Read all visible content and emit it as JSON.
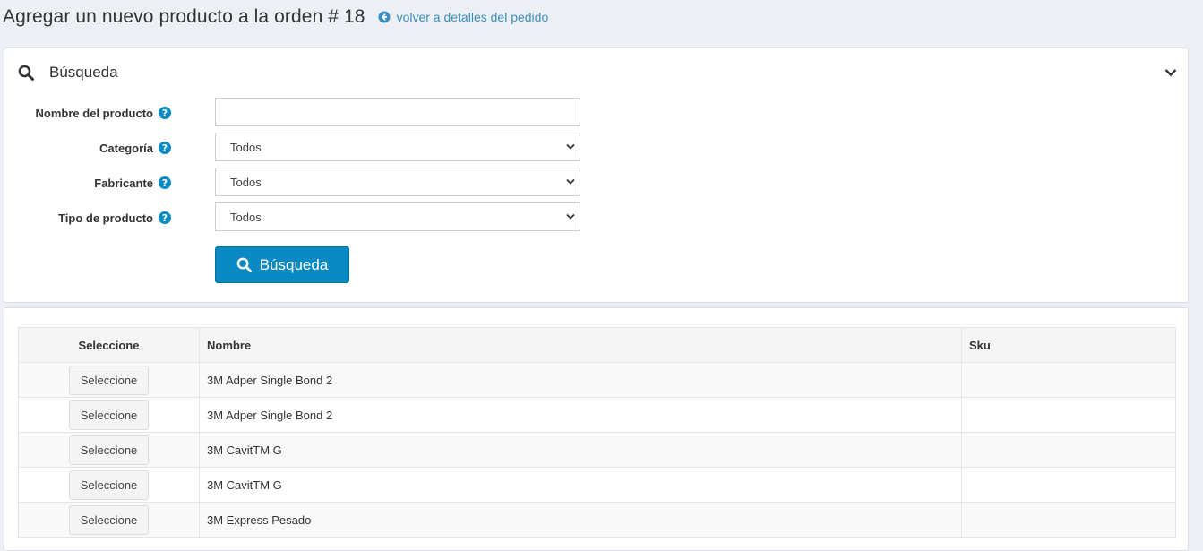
{
  "header": {
    "title": "Agregar un nuevo producto a la orden # 18",
    "back_link": "volver a detalles del pedido"
  },
  "search": {
    "title": "Búsqueda",
    "fields": {
      "product_name": {
        "label": "Nombre del producto",
        "value": ""
      },
      "category": {
        "label": "Categoría",
        "value": "Todos"
      },
      "manufacturer": {
        "label": "Fabricante",
        "value": "Todos"
      },
      "product_type": {
        "label": "Tipo de producto",
        "value": "Todos"
      }
    },
    "button_label": "Búsqueda"
  },
  "table": {
    "columns": [
      "Seleccione",
      "Nombre",
      "Sku"
    ],
    "rows": [
      {
        "select_label": "Seleccione",
        "name": "3M Adper Single Bond 2",
        "sku": ""
      },
      {
        "select_label": "Seleccione",
        "name": "3M Adper Single Bond 2",
        "sku": ""
      },
      {
        "select_label": "Seleccione",
        "name": "3M CavitTM G",
        "sku": ""
      },
      {
        "select_label": "Seleccione",
        "name": "3M CavitTM G",
        "sku": ""
      },
      {
        "select_label": "Seleccione",
        "name": "3M Express Pesado",
        "sku": ""
      }
    ]
  },
  "colors": {
    "accent": "#0a8ac2",
    "link": "#3c8dbc",
    "page_bg": "#ecf0f5"
  },
  "icons": [
    "arrow-circle-left-icon",
    "search-icon",
    "chevron-down-icon",
    "question-circle-icon"
  ]
}
